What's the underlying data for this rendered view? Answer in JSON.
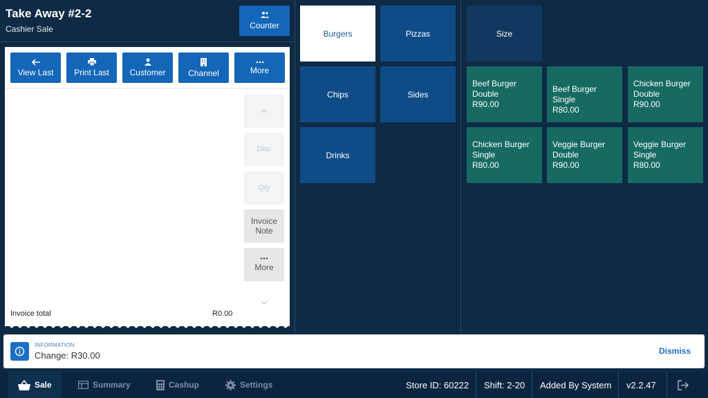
{
  "order": {
    "title": "Take Away #2-2",
    "subtitle": "Cashier Sale",
    "counter_label": "Counter"
  },
  "toolbar": [
    {
      "label": "View Last",
      "icon": "arrow-left-icon"
    },
    {
      "label": "Print Last",
      "icon": "printer-icon"
    },
    {
      "label": "Customer",
      "icon": "person-icon"
    },
    {
      "label": "Channel",
      "icon": "building-icon"
    },
    {
      "label": "More",
      "icon": "more-dots-icon"
    }
  ],
  "side_actions": {
    "disc": "Disc",
    "qty": "Qty",
    "invoice_note": "Invoice Note",
    "more": "More"
  },
  "invoice": {
    "total_label": "Invoice total",
    "total_value": "R0.00"
  },
  "categories": [
    "Burgers",
    "Pizzas",
    "Chips",
    "Sides",
    "Drinks"
  ],
  "selected_category": "Burgers",
  "size_label": "Size",
  "products": [
    {
      "name": "Beef Burger Double",
      "price": "R90.00"
    },
    {
      "name": "Beef Burger Single",
      "price": "R80.00"
    },
    {
      "name": "Chicken Burger Double",
      "price": "R90.00"
    },
    {
      "name": "Chicken Burger Single",
      "price": "R80.00"
    },
    {
      "name": "Veggie Burger Double",
      "price": "R90.00"
    },
    {
      "name": "Veggie Burger Single",
      "price": "R80.00"
    }
  ],
  "info": {
    "label": "INFORMATION",
    "message": "Change: R30.00",
    "dismiss": "Dismiss"
  },
  "nav": {
    "sale": "Sale",
    "summary": "Summary",
    "cashup": "Cashup",
    "settings": "Settings"
  },
  "status": {
    "store": "Store ID: 60222",
    "shift": "Shift: 2-20",
    "added_by": "Added By System",
    "version": "v2.2.47"
  },
  "colors": {
    "background": "#0e2a44",
    "primary_button": "#1466b8",
    "category_tile": "#0f4c87",
    "product_tile": "#166a62",
    "info_accent": "#1d6fc4"
  }
}
